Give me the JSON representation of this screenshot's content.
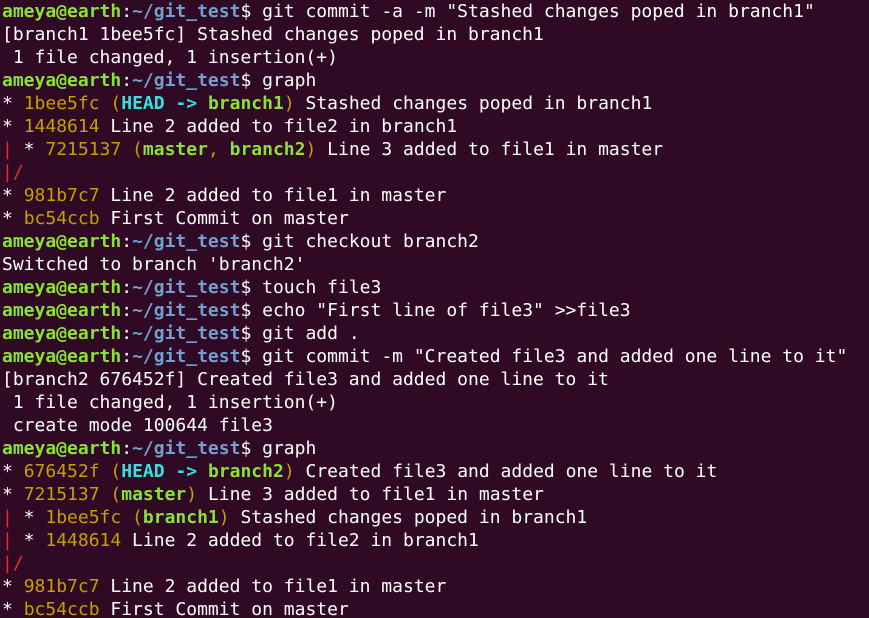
{
  "prompt": {
    "user_host": "ameya@earth",
    "sep": ":",
    "path": "~/git_test",
    "dollar": "$"
  },
  "colors": {
    "background": "#300a24",
    "prompt_user": "#8ae234",
    "prompt_path": "#729fcf",
    "commit_hash": "#c4a000",
    "head_label": "#34e2e2",
    "branch_label": "#8ae234",
    "graph_line": "#ef2929"
  },
  "lines": [
    {
      "type": "prompt",
      "command": " git commit -a -m \"Stashed changes poped in branch1\""
    },
    {
      "type": "output",
      "text": "[branch1 1bee5fc] Stashed changes poped in branch1"
    },
    {
      "type": "output",
      "text": " 1 file changed, 1 insertion(+)"
    },
    {
      "type": "prompt",
      "command": " graph"
    },
    {
      "type": "commit",
      "prefix": "* ",
      "hash": "1bee5fc",
      "refs": [
        {
          "kind": "head",
          "text": "HEAD"
        },
        {
          "kind": "arrow",
          "text": " -> "
        },
        {
          "kind": "branch",
          "text": "branch1"
        }
      ],
      "message": " Stashed changes poped in branch1"
    },
    {
      "type": "commit",
      "prefix": "* ",
      "hash": "1448614",
      "refs": [],
      "message": " Line 2 added to file2 in branch1"
    },
    {
      "type": "commit",
      "graph": "|",
      "prefix": " * ",
      "hash": "7215137",
      "refs": [
        {
          "kind": "branch",
          "text": "master"
        },
        {
          "kind": "comma",
          "text": ", "
        },
        {
          "kind": "branch",
          "text": "branch2"
        }
      ],
      "message": " Line 3 added to file1 in master"
    },
    {
      "type": "graph",
      "text": "|/"
    },
    {
      "type": "commit",
      "prefix": "* ",
      "hash": "981b7c7",
      "refs": [],
      "message": " Line 2 added to file1 in master"
    },
    {
      "type": "commit",
      "prefix": "* ",
      "hash": "bc54ccb",
      "refs": [],
      "message": " First Commit on master"
    },
    {
      "type": "prompt",
      "command": " git checkout branch2"
    },
    {
      "type": "output",
      "text": "Switched to branch 'branch2'"
    },
    {
      "type": "prompt",
      "command": " touch file3"
    },
    {
      "type": "prompt",
      "command": " echo \"First line of file3\" >>file3"
    },
    {
      "type": "prompt",
      "command": " git add ."
    },
    {
      "type": "prompt",
      "command": " git commit -m \"Created file3 and added one line to it\""
    },
    {
      "type": "output",
      "text": "[branch2 676452f] Created file3 and added one line to it"
    },
    {
      "type": "output",
      "text": " 1 file changed, 1 insertion(+)"
    },
    {
      "type": "output",
      "text": " create mode 100644 file3"
    },
    {
      "type": "prompt",
      "command": " graph"
    },
    {
      "type": "commit",
      "prefix": "* ",
      "hash": "676452f",
      "refs": [
        {
          "kind": "head",
          "text": "HEAD"
        },
        {
          "kind": "arrow",
          "text": " -> "
        },
        {
          "kind": "branch",
          "text": "branch2"
        }
      ],
      "message": " Created file3 and added one line to it"
    },
    {
      "type": "commit",
      "prefix": "* ",
      "hash": "7215137",
      "refs": [
        {
          "kind": "branch",
          "text": "master"
        }
      ],
      "message": " Line 3 added to file1 in master"
    },
    {
      "type": "commit",
      "graph": "|",
      "prefix": " * ",
      "hash": "1bee5fc",
      "refs": [
        {
          "kind": "branch",
          "text": "branch1"
        }
      ],
      "message": " Stashed changes poped in branch1"
    },
    {
      "type": "commit",
      "graph": "|",
      "prefix": " * ",
      "hash": "1448614",
      "refs": [],
      "message": " Line 2 added to file2 in branch1"
    },
    {
      "type": "graph",
      "text": "|/"
    },
    {
      "type": "commit",
      "prefix": "* ",
      "hash": "981b7c7",
      "refs": [],
      "message": " Line 2 added to file1 in master"
    },
    {
      "type": "commit",
      "prefix": "* ",
      "hash": "bc54ccb",
      "refs": [],
      "message": " First Commit on master"
    }
  ]
}
